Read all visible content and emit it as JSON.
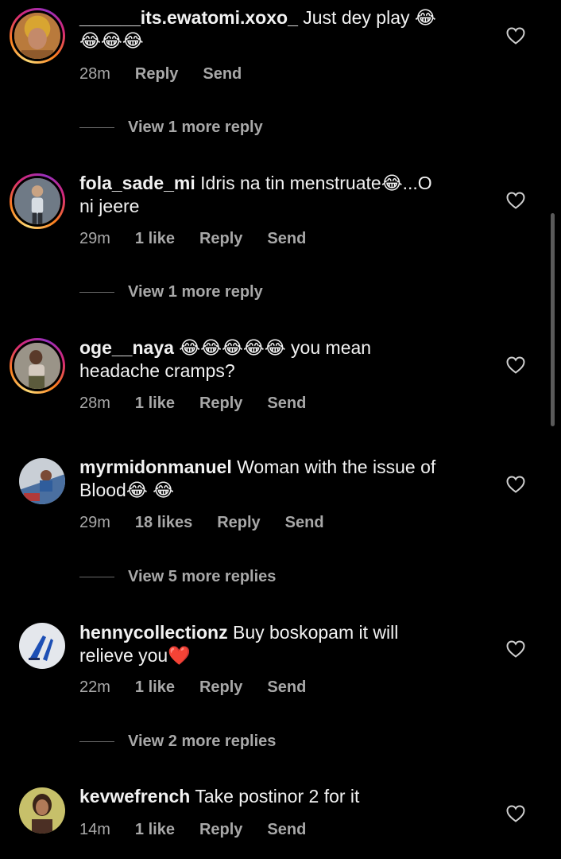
{
  "comments": [
    {
      "username": "______its.ewatomi.xoxo_",
      "text": " Just dey play 😂",
      "text2": "😂😂😂",
      "time": "28m",
      "likes": "",
      "reply": "Reply",
      "send": "Send",
      "view_more": "View 1 more reply"
    },
    {
      "username": "fola_sade_mi",
      "text": " Idris na tin menstruate😂...O",
      "text2": "ni jeere",
      "time": "29m",
      "likes": "1 like",
      "reply": "Reply",
      "send": "Send",
      "view_more": "View 1 more reply"
    },
    {
      "username": "oge__naya",
      "text": " 😂😂😂😂😂 you mean",
      "text2": "headache cramps?",
      "time": "28m",
      "likes": "1 like",
      "reply": "Reply",
      "send": "Send",
      "view_more": ""
    },
    {
      "username": "myrmidonmanuel",
      "text": " Woman with the issue of",
      "text2": "Blood😂 😂",
      "time": "29m",
      "likes": "18 likes",
      "reply": "Reply",
      "send": "Send",
      "view_more": "View 5 more replies"
    },
    {
      "username": "hennycollectionz",
      "text": " Buy boskopam it will",
      "text2": "relieve you❤️",
      "time": "22m",
      "likes": "1 like",
      "reply": "Reply",
      "send": "Send",
      "view_more": "View 2 more replies"
    },
    {
      "username": "kevwefrench",
      "text": " Take postinor 2 for it",
      "text2": "",
      "time": "14m",
      "likes": "1 like",
      "reply": "Reply",
      "send": "Send",
      "view_more": ""
    }
  ],
  "icons": {
    "like": "heart-outline-icon"
  },
  "colors": {
    "background": "#000000",
    "secondary_text": "#a8a8a8",
    "primary_text": "#f2f2f2"
  }
}
